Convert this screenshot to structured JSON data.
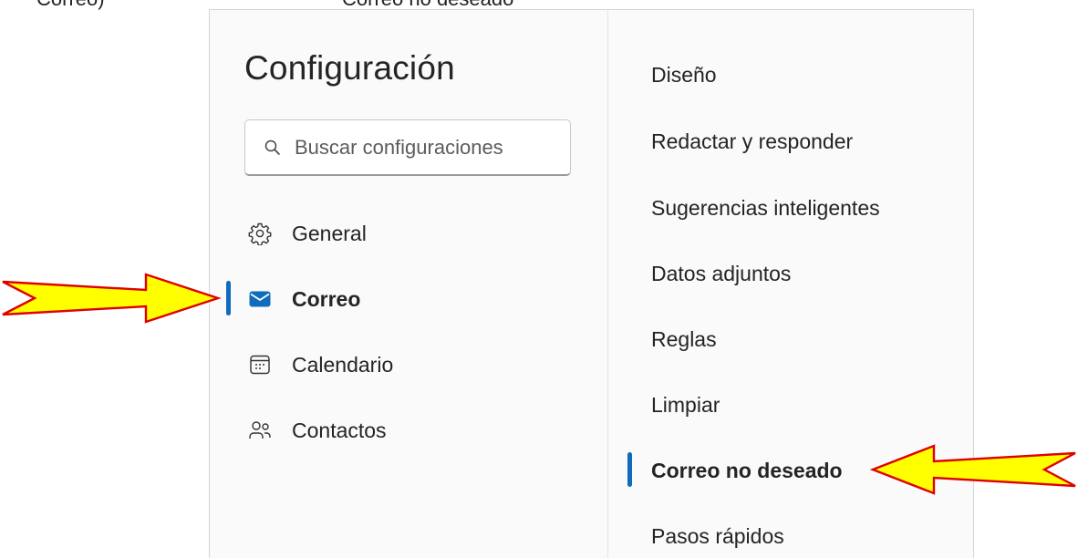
{
  "cut_text": {
    "left": "Correo)",
    "right": "Correo no deseado"
  },
  "settings": {
    "title": "Configuración",
    "search": {
      "placeholder": "Buscar configuraciones",
      "value": ""
    }
  },
  "nav": {
    "items": [
      {
        "label": "General",
        "icon": "gear-icon"
      },
      {
        "label": "Correo",
        "icon": "mail-icon",
        "selected": true
      },
      {
        "label": "Calendario",
        "icon": "calendar-icon"
      },
      {
        "label": "Contactos",
        "icon": "people-icon"
      }
    ]
  },
  "mail_subnav": {
    "items": [
      {
        "label": "Diseño"
      },
      {
        "label": "Redactar y responder"
      },
      {
        "label": "Sugerencias inteligentes"
      },
      {
        "label": "Datos adjuntos"
      },
      {
        "label": "Reglas"
      },
      {
        "label": "Limpiar"
      },
      {
        "label": "Correo no deseado",
        "selected": true
      },
      {
        "label": "Pasos rápidos"
      }
    ]
  },
  "colors": {
    "accent": "#0f6cbd",
    "arrow_fill": "#ffff00",
    "arrow_stroke": "#e00000"
  }
}
